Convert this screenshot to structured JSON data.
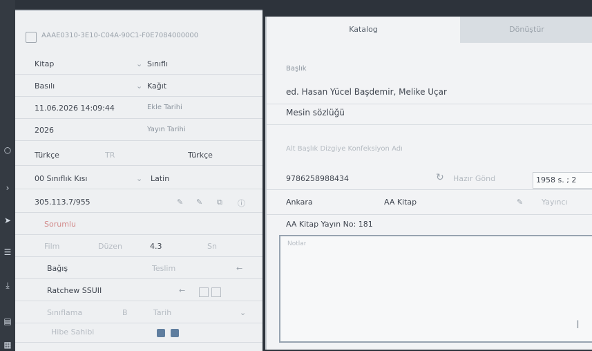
{
  "record": {
    "id": "AAAE0310-3E10-C04A-90C1-F0E7084000000",
    "fields": [
      {
        "value": "Kitap",
        "label": "Sınıflı"
      },
      {
        "value": "Basılı",
        "label": "Kağıt"
      },
      {
        "value": "11.06.2026 14:09:44",
        "label": "Ekle Tarihi"
      },
      {
        "value": "2026",
        "label": "Yayın Tarihi"
      }
    ],
    "language_row": {
      "from": "Türkçe",
      "to": "Türkçe",
      "sep": "TR"
    },
    "class_row": {
      "value": "00 Sınıflık Kısı",
      "label": "Latin"
    },
    "dewey_row": {
      "value": "305.113.7/955"
    },
    "author_label": "Sorumlu",
    "misc_row": {
      "a": "Film",
      "b": "Düzen",
      "c": "4.3",
      "d": "Sn"
    },
    "scope_row": {
      "a": "Bağış",
      "b": "Teslim"
    },
    "member_row": {
      "label": "Ratchew SSUII"
    },
    "sort_row": {
      "a": "Sınıflama",
      "b": "Tarih",
      "c": "B"
    },
    "check_row": {
      "a": "Hibe Sahibi"
    }
  },
  "tabs": [
    {
      "label": "Katalog",
      "active": true
    },
    {
      "label": "Dönüştür",
      "active": false
    }
  ],
  "catalog": {
    "title_label": "Başlık",
    "title_value": "ed. Hasan Yücel Başdemir, Melike Uçar",
    "subtitle_value": "Mesin sözlüğü",
    "note_label": "Alt Başlık Dizgiye Konfeksiyon Adı",
    "isbn": "9786258988434",
    "refresh_label": "Hazır Gönd",
    "year_box": "1958 s. ; 2",
    "publisher_city": "Ankara",
    "publisher": "AA Kitap",
    "publisher_label": "Yayıncı",
    "series": "AA Kitap Yayın No: 181",
    "notes_placeholder": "Notlar"
  }
}
